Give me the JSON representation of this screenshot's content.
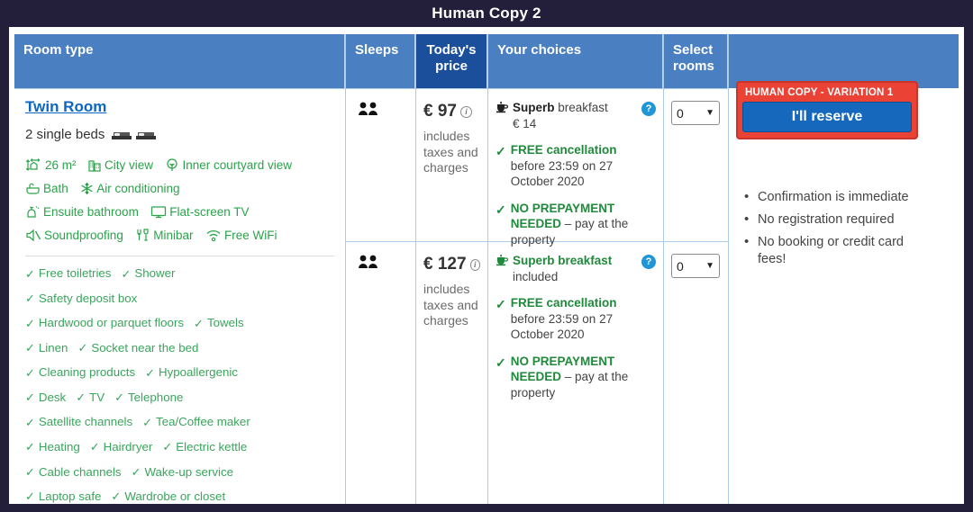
{
  "window": {
    "title": "Human Copy 2"
  },
  "table": {
    "headers": {
      "room_type": "Room type",
      "sleeps": "Sleeps",
      "todays_price": "Today's price",
      "your_choices": "Your choices",
      "select_rooms": "Select rooms",
      "reserve": ""
    }
  },
  "room": {
    "name": "Twin Room",
    "beds": "2 single beds",
    "features": [
      {
        "label": "26 m²",
        "icon": "room-size-icon"
      },
      {
        "label": "City view",
        "icon": "city-view-icon"
      },
      {
        "label": "Inner courtyard view",
        "icon": "courtyard-view-icon"
      },
      {
        "label": "Bath",
        "icon": "bath-icon"
      },
      {
        "label": "Air conditioning",
        "icon": "snowflake-icon"
      },
      {
        "label": "Ensuite bathroom",
        "icon": "ensuite-bathroom-icon"
      },
      {
        "label": "Flat-screen TV",
        "icon": "tv-icon"
      },
      {
        "label": "Soundproofing",
        "icon": "soundproofing-icon"
      },
      {
        "label": "Minibar",
        "icon": "minibar-icon"
      },
      {
        "label": "Free WiFi",
        "icon": "wifi-icon"
      }
    ],
    "amenity_rows": [
      [
        "Free toiletries",
        "Shower"
      ],
      [
        "Safety deposit box"
      ],
      [
        "Hardwood or parquet floors",
        "Towels"
      ],
      [
        "Linen",
        "Socket near the bed"
      ],
      [
        "Cleaning products",
        "Hypoallergenic"
      ],
      [
        "Desk",
        "TV",
        "Telephone"
      ],
      [
        "Satellite channels",
        "Tea/Coffee maker"
      ],
      [
        "Heating",
        "Hairdryer",
        "Electric kettle"
      ],
      [
        "Cable channels",
        "Wake-up service"
      ],
      [
        "Laptop safe",
        "Wardrobe or closet"
      ]
    ],
    "tick_glyph": "✓"
  },
  "rows": [
    {
      "sleeps_count": 2,
      "price": "€ 97",
      "price_note": "includes taxes and charges",
      "breakfast_strong": "Superb",
      "breakfast_rest": " breakfast",
      "breakfast_sub": "€ 14",
      "breakfast_all_green": false,
      "cancellation_strong": "FREE cancellation",
      "cancellation_rest": "before 23:59 on 27 October 2020",
      "prepayment_strong": "NO PREPAYMENT NEEDED",
      "prepayment_rest": " – pay at the property",
      "select_value": "0",
      "help_glyph": "?"
    },
    {
      "sleeps_count": 2,
      "price": "€ 127",
      "price_note": "includes taxes and charges",
      "breakfast_strong": "Superb breakfast",
      "breakfast_rest": "",
      "breakfast_sub": "included",
      "breakfast_all_green": true,
      "cancellation_strong": "FREE cancellation",
      "cancellation_rest": "before 23:59 on 27 October 2020",
      "prepayment_strong": "NO PREPAYMENT NEEDED",
      "prepayment_rest": " – pay at the property",
      "select_value": "0",
      "help_glyph": "?"
    }
  ],
  "reserve_panel": {
    "badge": "HUMAN COPY - VARIATION 1",
    "button": "I'll reserve",
    "bullets": [
      "Confirmation is immediate",
      "No registration required",
      "No booking or credit card fees!"
    ]
  },
  "colors": {
    "titlebar_bg": "#231f3a",
    "header_blue": "#4a7fc1",
    "header_dark_blue": "#1b4f9c",
    "link_blue": "#0a66c2",
    "green": "#1f8a3b",
    "feature_green": "#2aa34a",
    "badge_red": "#ea4335",
    "reserve_blue": "#1668bd",
    "help_blue": "#2196d6"
  }
}
